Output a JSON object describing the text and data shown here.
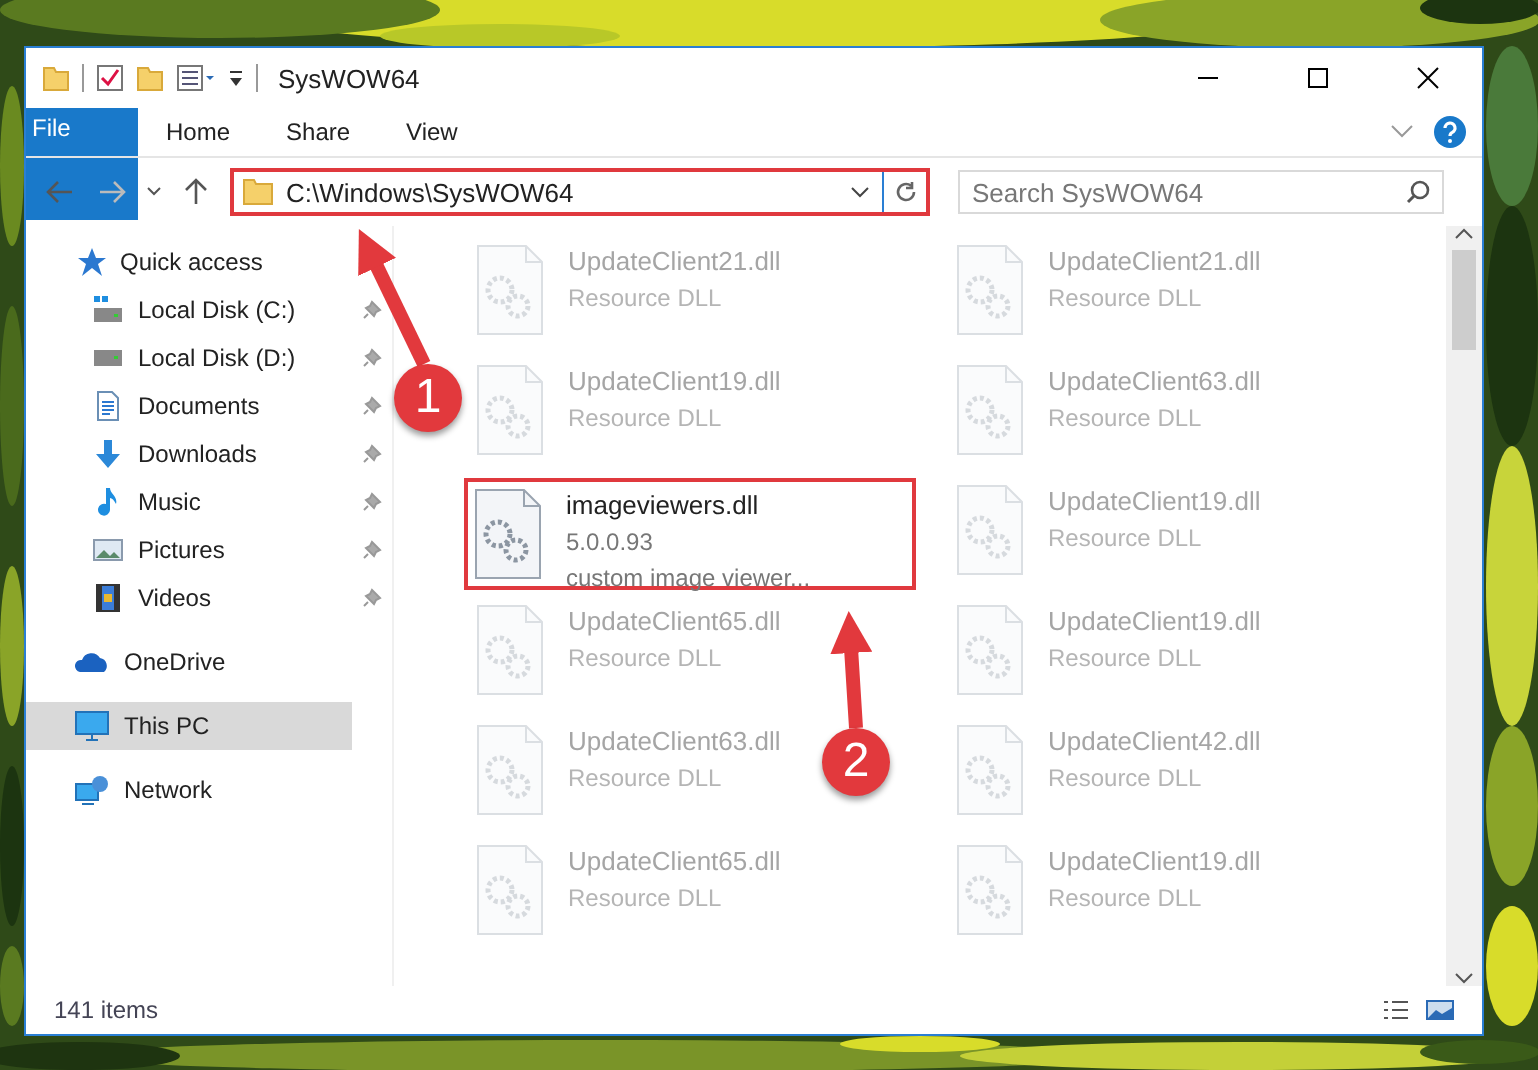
{
  "window": {
    "title": "SysWOW64"
  },
  "ribbon_tabs": [
    {
      "label": "File",
      "kind": "file"
    },
    {
      "label": "Home",
      "kind": "tab"
    },
    {
      "label": "Share",
      "kind": "tab"
    },
    {
      "label": "View",
      "kind": "tab"
    }
  ],
  "address": {
    "path": "C:\\Windows\\SysWOW64"
  },
  "search": {
    "placeholder": "Search SysWOW64"
  },
  "nav": [
    {
      "label": "Quick access",
      "kind": "star",
      "selected": false,
      "pinned": false
    },
    {
      "label": "Local Disk (C:)",
      "kind": "disk-c",
      "selected": false,
      "pinned": true
    },
    {
      "label": "Local Disk (D:)",
      "kind": "disk",
      "selected": false,
      "pinned": true
    },
    {
      "label": "Documents",
      "kind": "doc",
      "selected": false,
      "pinned": true
    },
    {
      "label": "Downloads",
      "kind": "download",
      "selected": false,
      "pinned": true
    },
    {
      "label": "Music",
      "kind": "music",
      "selected": false,
      "pinned": true
    },
    {
      "label": "Pictures",
      "kind": "pictures",
      "selected": false,
      "pinned": true
    },
    {
      "label": "Videos",
      "kind": "videos",
      "selected": false,
      "pinned": true
    },
    {
      "label": "OneDrive",
      "kind": "cloud",
      "selected": false,
      "pinned": false
    },
    {
      "label": "This PC",
      "kind": "pc",
      "selected": true,
      "pinned": false
    },
    {
      "label": "Network",
      "kind": "network",
      "selected": false,
      "pinned": false
    }
  ],
  "files": [
    {
      "name": "UpdateClient21.dll",
      "lines": [
        "Resource DLL"
      ],
      "blurred": true,
      "highlighted": false
    },
    {
      "name": "UpdateClient21.dll",
      "lines": [
        "Resource DLL"
      ],
      "blurred": true,
      "highlighted": false
    },
    {
      "name": "UpdateClient19.dll",
      "lines": [
        "Resource DLL"
      ],
      "blurred": true,
      "highlighted": false
    },
    {
      "name": "UpdateClient63.dll",
      "lines": [
        "Resource DLL"
      ],
      "blurred": true,
      "highlighted": false
    },
    {
      "name": "imageviewers.dll",
      "lines": [
        "5.0.0.93",
        "custom image viewer..."
      ],
      "blurred": false,
      "highlighted": true
    },
    {
      "name": "UpdateClient19.dll",
      "lines": [
        "Resource DLL"
      ],
      "blurred": true,
      "highlighted": false
    },
    {
      "name": "UpdateClient65.dll",
      "lines": [
        "Resource DLL"
      ],
      "blurred": true,
      "highlighted": false
    },
    {
      "name": "UpdateClient19.dll",
      "lines": [
        "Resource DLL"
      ],
      "blurred": true,
      "highlighted": false
    },
    {
      "name": "UpdateClient63.dll",
      "lines": [
        "Resource DLL"
      ],
      "blurred": true,
      "highlighted": false
    },
    {
      "name": "UpdateClient42.dll",
      "lines": [
        "Resource DLL"
      ],
      "blurred": true,
      "highlighted": false
    },
    {
      "name": "UpdateClient65.dll",
      "lines": [
        "Resource DLL"
      ],
      "blurred": true,
      "highlighted": false
    },
    {
      "name": "UpdateClient19.dll",
      "lines": [
        "Resource DLL"
      ],
      "blurred": true,
      "highlighted": false
    }
  ],
  "status_bar": {
    "count": "141 items"
  },
  "annotations": [
    {
      "label": "1"
    },
    {
      "label": "2"
    }
  ]
}
